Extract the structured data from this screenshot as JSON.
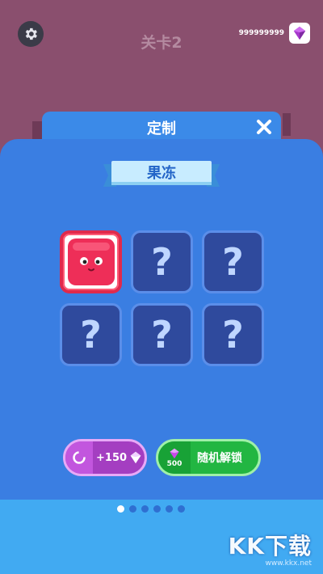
{
  "hud": {
    "level_label": "关卡2",
    "gem_count": "999999999"
  },
  "dialog": {
    "title": "定制",
    "category": "果冻",
    "grid": {
      "cells": [
        {
          "state": "owned",
          "icon": "red-jelly-face"
        },
        {
          "state": "locked",
          "symbol": "?"
        },
        {
          "state": "locked",
          "symbol": "?"
        },
        {
          "state": "locked",
          "symbol": "?"
        },
        {
          "state": "locked",
          "symbol": "?"
        },
        {
          "state": "locked",
          "symbol": "?"
        }
      ]
    },
    "ad_button": {
      "reward": "+150"
    },
    "unlock_button": {
      "cost": "500",
      "label": "随机解锁"
    },
    "pagination": {
      "pages": 6,
      "current": 1
    }
  },
  "watermark": {
    "main": "KK下载",
    "sub": "www.kkx.net"
  },
  "colors": {
    "panel": "#3a7ee2",
    "selected_border": "#e02a4c",
    "jelly": "#ee2e58",
    "unlock_green": "#22b642",
    "ad_purple": "#a43ec1"
  }
}
